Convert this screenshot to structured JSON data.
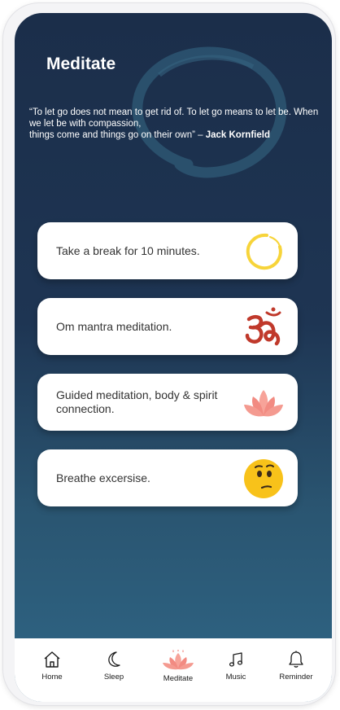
{
  "header": {
    "title": "Meditate",
    "quote_text": "“To let go does not mean to get rid of. To let go means to let be. When we let be with compassion,",
    "quote_line3": "things come and things go on their own” – ",
    "quote_author": "Jack Kornfield"
  },
  "cards": [
    {
      "label": "Take a break for 10 minutes.",
      "icon": "enso-circle-icon"
    },
    {
      "label": "Om mantra meditation.",
      "icon": "om-symbol-icon"
    },
    {
      "label": "Guided meditation, body & spirit connection.",
      "icon": "lotus-icon"
    },
    {
      "label": "Breathe excersise.",
      "icon": "thinking-face-icon"
    }
  ],
  "tabbar": {
    "items": [
      {
        "label": "Home",
        "icon": "home-icon"
      },
      {
        "label": "Sleep",
        "icon": "moon-icon"
      },
      {
        "label": "Meditate",
        "icon": "lotus-icon",
        "active": true
      },
      {
        "label": "Music",
        "icon": "music-note-icon"
      },
      {
        "label": "Reminder",
        "icon": "bell-icon"
      }
    ]
  },
  "colors": {
    "background_top": "#1b2e4a",
    "background_bottom": "#2f6686",
    "enso_yellow": "#f7d43a",
    "om_red": "#c0392b",
    "lotus_pink": "#f28b82",
    "emoji_yellow": "#f8c21a"
  }
}
